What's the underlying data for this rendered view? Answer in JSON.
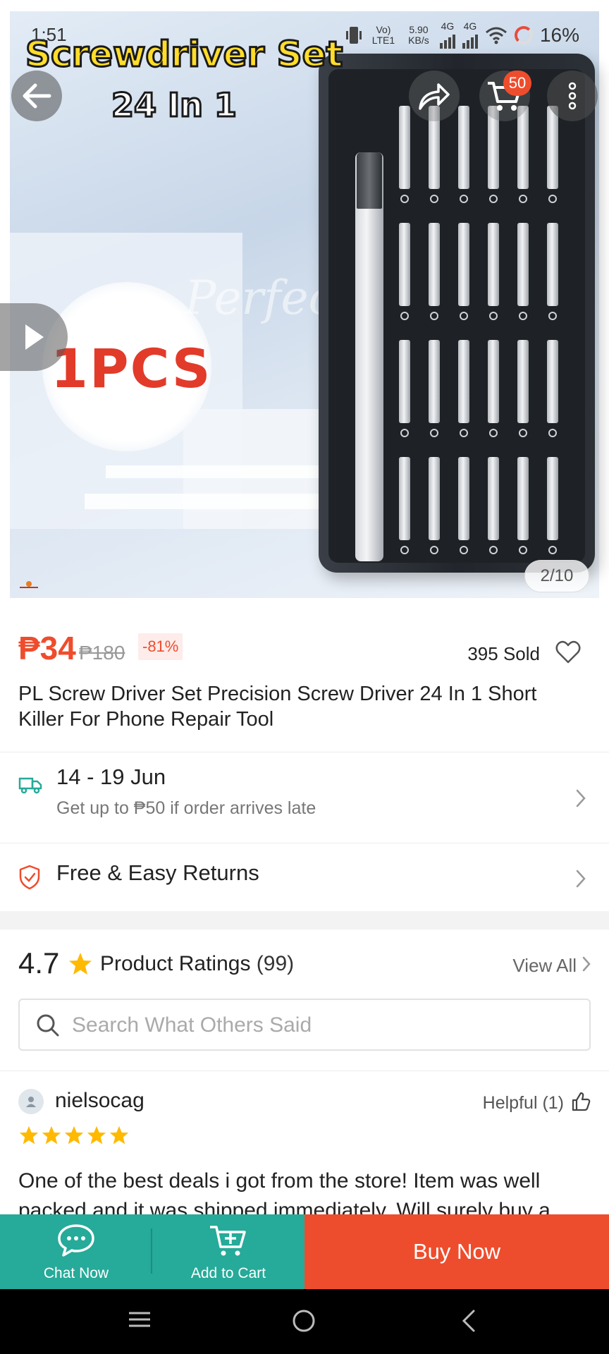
{
  "status_bar": {
    "time": "1:51",
    "network_lte": "Vo) LTE1",
    "speed": "5.90 KB/s",
    "net1": "4G",
    "net2": "4G",
    "battery": "16%"
  },
  "hero": {
    "title": "Screwdriver Set",
    "subtitle": "24 In 1",
    "badge_text": "1PCS",
    "watermark": "Perfect",
    "page_indicator": "2/10",
    "cart_count": "50",
    "icons": {
      "back": "back-arrow-icon",
      "share": "share-icon",
      "cart": "cart-icon",
      "more": "more-vertical-icon",
      "play": "play-icon"
    }
  },
  "product": {
    "price": "₱34",
    "original_price": "₱180",
    "discount": "-81%",
    "sold": "395 Sold",
    "title": "PL Screw Driver Set Precision Screw Driver 24 In 1 Short Killer For Phone Repair Tool"
  },
  "delivery": {
    "dates": "14 - 19 Jun",
    "guarantee": "Get up to ₱50 if order arrives late"
  },
  "returns": {
    "label": "Free & Easy Returns"
  },
  "ratings": {
    "score": "4.7",
    "label": "Product Ratings",
    "count": "(99)",
    "view_all": "View All",
    "search_placeholder": "Search What Others Said"
  },
  "review": {
    "user": "nielsocag",
    "helpful": "Helpful (1)",
    "stars": 5,
    "text": "One of the best deals i got from the store! Item was well packed and it was shipped immediately. Will surely buy a"
  },
  "actions": {
    "chat": "Chat Now",
    "add_to_cart": "Add to Cart",
    "buy_now": "Buy Now"
  },
  "colors": {
    "brand": "#ee4d2d",
    "teal": "#26aa99",
    "star": "#ffb900"
  }
}
